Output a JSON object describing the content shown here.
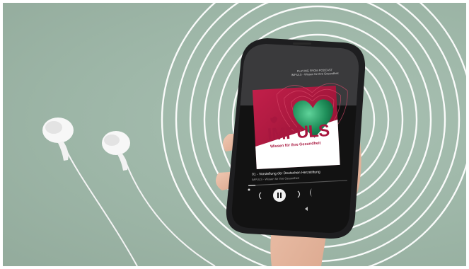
{
  "scene": {
    "background_color": "#9db6a7",
    "ring_color": "#ffffff",
    "accent_color": "#a8173f",
    "heart_color": "#1f8f5a"
  },
  "phone": {
    "now_playing_line1": "PLAYING FROM PODCAST",
    "now_playing_line2": "IMPULS - Wissen für Ihre Gesundheit",
    "cover": {
      "logo_im": "IM",
      "logo_puls": "PULS",
      "logo_subtitle": "Wissen für Ihre Gesundheit"
    },
    "track_title": "01 - Vorstellung der Deutschen Herzstiftung",
    "track_subtitle": "IMPULS - Wissen für Ihre Gesundheit"
  }
}
